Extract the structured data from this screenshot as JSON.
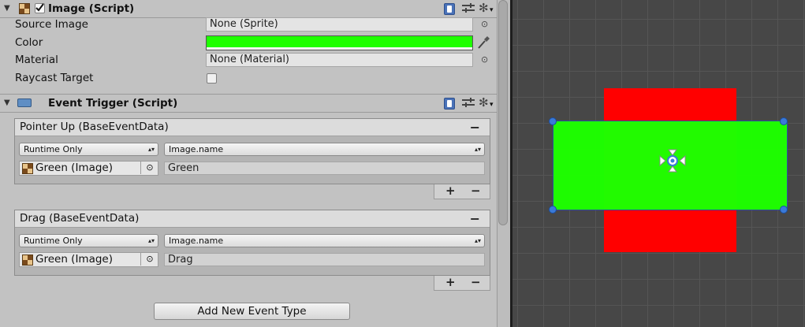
{
  "image_component": {
    "title": "Image (Script)",
    "enabled": true,
    "properties": {
      "source_image_label": "Source Image",
      "source_image_value": "None (Sprite)",
      "color_label": "Color",
      "color_value": "#1eff00",
      "material_label": "Material",
      "material_value": "None (Material)",
      "raycast_label": "Raycast Target",
      "raycast_checked": false
    }
  },
  "event_trigger": {
    "title": "Event Trigger (Script)",
    "events": [
      {
        "title": "Pointer Up (BaseEventData)",
        "runtime": "Runtime Only",
        "function": "Image.name",
        "object": "Green (Image)",
        "argument": "Green"
      },
      {
        "title": "Drag (BaseEventData)",
        "runtime": "Runtime Only",
        "function": "Image.name",
        "object": "Green (Image)",
        "argument": "Drag"
      }
    ],
    "add_button": "Add New Event Type"
  },
  "symbols": {
    "fold_arrow": "▼",
    "minus": "−",
    "plus": "+",
    "target": "⊙",
    "dropdown_arrow": "▴▾",
    "gear": "✻",
    "gear_caret": "▾"
  },
  "scene": {
    "red_color": "#ff0000",
    "green_color": "#1eff00"
  }
}
